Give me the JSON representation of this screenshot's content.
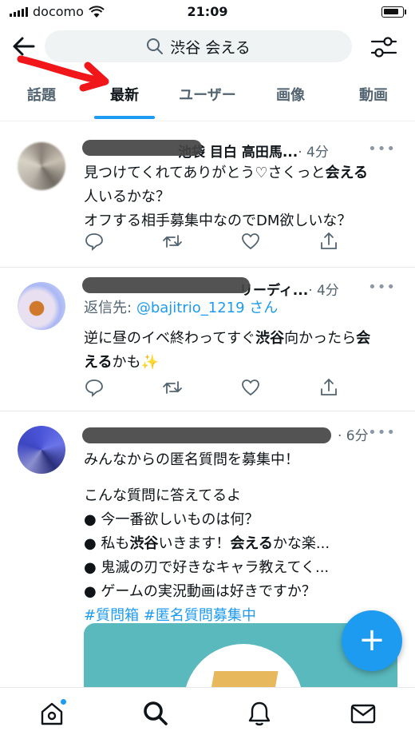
{
  "status_bar": {
    "carrier": "docomo",
    "time": "21:09"
  },
  "search": {
    "query": "渋谷 会える"
  },
  "tabs": [
    {
      "label": "話題",
      "active": false
    },
    {
      "label": "最新",
      "active": true
    },
    {
      "label": "ユーザー",
      "active": false
    },
    {
      "label": "画像",
      "active": false
    },
    {
      "label": "動画",
      "active": false
    }
  ],
  "tweets": [
    {
      "name_visible": "池袋 目白 高田馬...",
      "time": "· 4分",
      "lines": [
        [
          "見つけてくれてありがとう♡さくっと",
          "会える"
        ],
        [
          "人いるかな？"
        ],
        [
          "オフする相手募集中なのでDM欲しいな？"
        ]
      ]
    },
    {
      "name_visible": "リーディ...",
      "time": "· 4分",
      "reply_label": "返信先:",
      "reply_handle": "@bajitrio_1219 さん",
      "text_a": "逆に昼のイベ終わってすぐ",
      "bold_a": "渋谷",
      "text_b": "向かったら",
      "bold_b": "会",
      "bold_c": "える",
      "text_c": "かも✨"
    },
    {
      "time": "· 6分",
      "line1": "みんなからの匿名質問を募集中！",
      "line2": "こんな質問に答えてるよ",
      "q1": "● 今一番欲しいものは何？",
      "q2a": "● 私も",
      "q2b": "渋谷",
      "q2c": "いきます！",
      "q2d": "会える",
      "q2e": "かな楽...",
      "q3": "● 鬼滅の刃で好きなキャラ教えてく...",
      "q4": "● ゲームの実況動画は好きですか？",
      "hashtags": "#質問箱 #匿名質問募集中"
    }
  ],
  "colors": {
    "accent": "#1d9bf0",
    "text": "#0f1419",
    "muted": "#536471"
  },
  "icons": [
    "back-arrow-icon",
    "search-icon",
    "filter-icon",
    "reply-icon",
    "retweet-icon",
    "like-icon",
    "share-icon",
    "compose-icon",
    "home-icon",
    "explore-icon",
    "notifications-icon",
    "messages-icon"
  ]
}
